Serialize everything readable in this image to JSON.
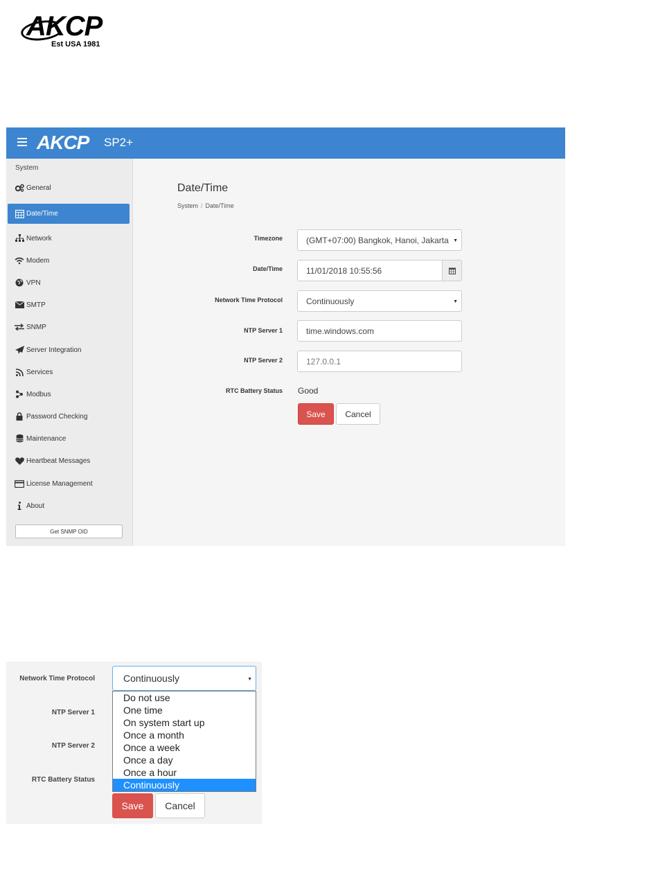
{
  "document": {
    "logo_text": "AKCP",
    "logo_tagline": "Est USA 1981"
  },
  "app": {
    "brand": "AKCP",
    "product": "SP2+"
  },
  "sidebar": {
    "heading": "System",
    "items": [
      {
        "label": "General",
        "icon": "gears-icon"
      },
      {
        "label": "Date/Time",
        "icon": "calendar-icon",
        "active": true
      },
      {
        "label": "Network",
        "icon": "sitemap-icon"
      },
      {
        "label": "Modem",
        "icon": "wifi-icon"
      },
      {
        "label": "VPN",
        "icon": "globe-icon"
      },
      {
        "label": "SMTP",
        "icon": "envelope-icon"
      },
      {
        "label": "SNMP",
        "icon": "exchange-icon"
      },
      {
        "label": "Server Integration",
        "icon": "paper-plane-icon"
      },
      {
        "label": "Services",
        "icon": "rss-icon"
      },
      {
        "label": "Modbus",
        "icon": "modbus-icon"
      },
      {
        "label": "Password Checking",
        "icon": "lock-icon"
      },
      {
        "label": "Maintenance",
        "icon": "database-icon"
      },
      {
        "label": "Heartbeat Messages",
        "icon": "heart-icon"
      },
      {
        "label": "License Management",
        "icon": "credit-card-icon"
      },
      {
        "label": "About",
        "icon": "info-icon"
      }
    ],
    "snmp_button": "Get SNMP OID"
  },
  "main": {
    "title": "Date/Time",
    "breadcrumb": [
      "System",
      "Date/Time"
    ],
    "form": {
      "timezone_label": "Timezone",
      "timezone_value": "(GMT+07:00) Bangkok, Hanoi, Jakarta",
      "datetime_label": "Date/Time",
      "datetime_value": "11/01/2018 10:55:56",
      "ntp_label": "Network Time Protocol",
      "ntp_value": "Continuously",
      "ntp1_label": "NTP Server 1",
      "ntp1_value": "time.windows.com",
      "ntp2_label": "NTP Server 2",
      "ntp2_value": "127.0.0.1",
      "rtc_label": "RTC Battery Status",
      "rtc_value": "Good"
    },
    "save_label": "Save",
    "cancel_label": "Cancel"
  },
  "dropdown_view": {
    "ntp_label": "Network Time Protocol",
    "ntp1_label": "NTP Server 1",
    "ntp2_label": "NTP Server 2",
    "rtc_label": "RTC Battery Status",
    "selected": "Continuously",
    "options": [
      "Do not use",
      "One time",
      "On system start up",
      "Once a month",
      "Once a week",
      "Once a day",
      "Once a hour",
      "Continuously"
    ],
    "save_label": "Save",
    "cancel_label": "Cancel"
  }
}
